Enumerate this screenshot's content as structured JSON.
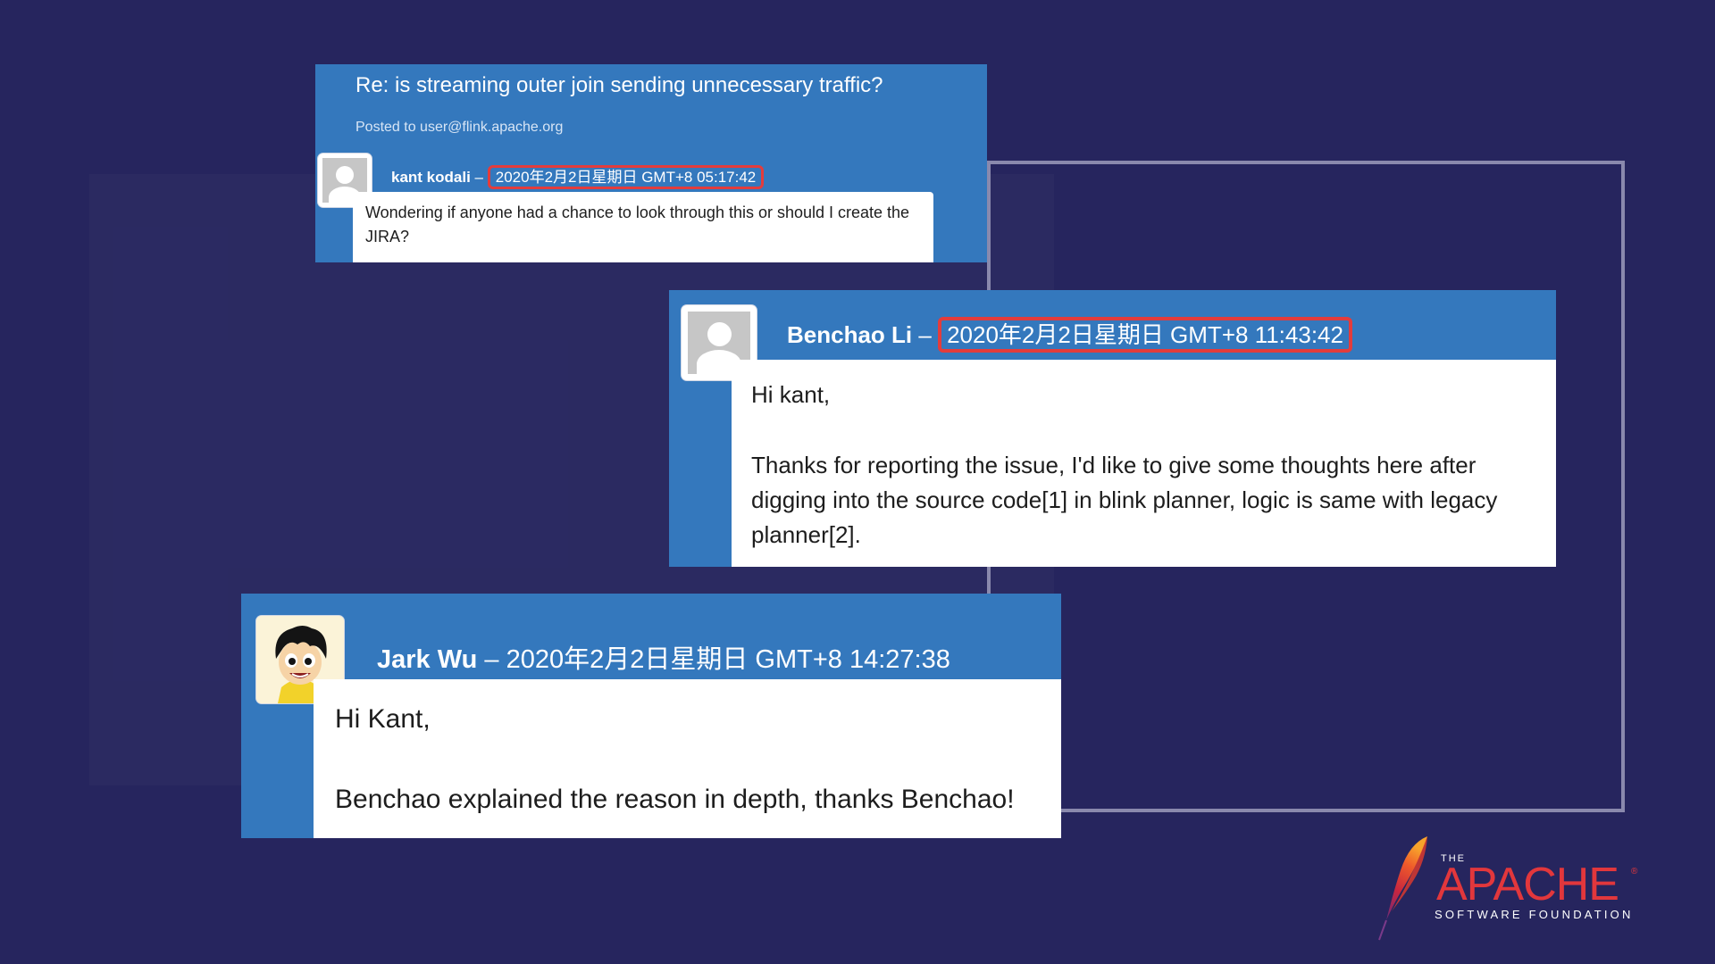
{
  "thread": {
    "title": "Re: is streaming outer join sending unnecessary traffic?",
    "posted_to": "Posted to user@flink.apache.org"
  },
  "messages": [
    {
      "author": "kant kodali",
      "separator": "–",
      "timestamp": "2020年2月2日星期日 GMT+8 05:17:42",
      "timestamp_highlighted": true,
      "avatar_icon": "default-user-icon",
      "body": [
        "Wondering if anyone had a chance to look through this or should I create the JIRA?"
      ]
    },
    {
      "author": "Benchao Li",
      "separator": "–",
      "timestamp": "2020年2月2日星期日 GMT+8 11:43:42",
      "timestamp_highlighted": true,
      "avatar_icon": "default-user-icon",
      "body": [
        "Hi kant,",
        "Thanks for reporting the issue, I'd like to give some thoughts here after digging into the source code[1] in blink planner, logic is same with legacy planner[2]."
      ]
    },
    {
      "author": "Jark Wu",
      "separator": "–",
      "timestamp": "2020年2月2日星期日 GMT+8 14:27:38",
      "timestamp_highlighted": false,
      "avatar_icon": "cartoon-avatar-icon",
      "body": [
        "Hi Kant,",
        "Benchao explained the reason in depth, thanks Benchao!"
      ]
    }
  ],
  "logo": {
    "the": "THE",
    "name": "APACHE",
    "registered": "®",
    "subtitle": "SOFTWARE FOUNDATION",
    "icon": "feather-icon"
  },
  "colors": {
    "background": "#26255e",
    "card_blue": "#3478bd",
    "highlight_red": "#e33c3c",
    "apache_red": "#e2373c"
  }
}
